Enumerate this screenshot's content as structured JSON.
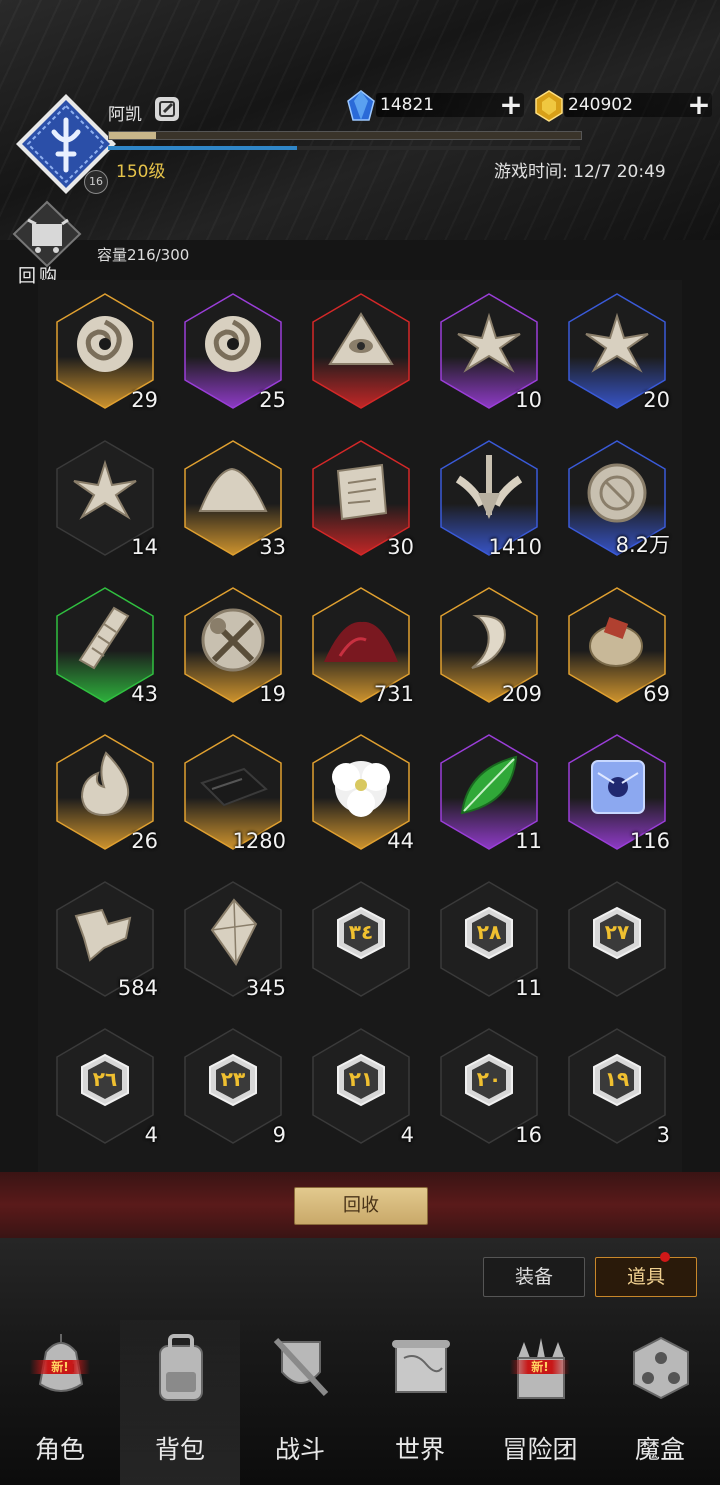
{
  "player": {
    "name": "阿凯",
    "level_text": "150级",
    "badge": "16",
    "xp_progress": 0.1,
    "mp_progress": 0.4
  },
  "currency": {
    "gems": "14821",
    "gold": "240902"
  },
  "game_time": "游戏时间: 12/7 20:49",
  "buyback": {
    "label": "回购"
  },
  "capacity": "容量216/300",
  "items": [
    {
      "count": "29",
      "rarity": "orange",
      "icon": "vortex-icon"
    },
    {
      "count": "25",
      "rarity": "purple",
      "icon": "vortex-icon"
    },
    {
      "count": "",
      "rarity": "red",
      "icon": "eye-pyramid-icon"
    },
    {
      "count": "10",
      "rarity": "purple",
      "icon": "crystal-shards-icon"
    },
    {
      "count": "20",
      "rarity": "blue",
      "icon": "crystal-shards-icon"
    },
    {
      "count": "14",
      "rarity": "none",
      "icon": "crystal-shards-icon"
    },
    {
      "count": "33",
      "rarity": "orange",
      "icon": "powder-pile-icon"
    },
    {
      "count": "30",
      "rarity": "red",
      "icon": "scroll-icon"
    },
    {
      "count": "1410",
      "rarity": "blue",
      "icon": "winged-sword-emblem-icon"
    },
    {
      "count": "8.2万",
      "rarity": "blue",
      "icon": "medallion-icon"
    },
    {
      "count": "43",
      "rarity": "green",
      "icon": "bandage-icon"
    },
    {
      "count": "19",
      "rarity": "orange",
      "icon": "crossed-tools-emblem-icon"
    },
    {
      "count": "731",
      "rarity": "orange",
      "icon": "red-powder-icon"
    },
    {
      "count": "209",
      "rarity": "orange",
      "icon": "fang-icon"
    },
    {
      "count": "69",
      "rarity": "orange",
      "icon": "pouch-icon"
    },
    {
      "count": "26",
      "rarity": "orange",
      "icon": "flame-icon"
    },
    {
      "count": "1280",
      "rarity": "orange",
      "icon": "black-card-icon"
    },
    {
      "count": "44",
      "rarity": "orange",
      "icon": "white-flower-icon"
    },
    {
      "count": "11",
      "rarity": "purple",
      "icon": "green-leaf-icon"
    },
    {
      "count": "116",
      "rarity": "purple",
      "icon": "ice-cube-icon"
    },
    {
      "count": "584",
      "rarity": "none",
      "icon": "rock-fragment-icon"
    },
    {
      "count": "345",
      "rarity": "none",
      "icon": "crystal-icon"
    },
    {
      "count": "",
      "rarity": "none",
      "icon": "rune-gem-icon",
      "rune": "٣٤"
    },
    {
      "count": "11",
      "rarity": "none",
      "icon": "rune-gem-icon",
      "rune": "٢٨"
    },
    {
      "count": "",
      "rarity": "none",
      "icon": "rune-gem-icon",
      "rune": "٢٧"
    },
    {
      "count": "4",
      "rarity": "none",
      "icon": "rune-gem-icon",
      "rune": "٢٦"
    },
    {
      "count": "9",
      "rarity": "none",
      "icon": "rune-gem-icon",
      "rune": "٢٣"
    },
    {
      "count": "4",
      "rarity": "none",
      "icon": "rune-gem-icon",
      "rune": "٢١"
    },
    {
      "count": "16",
      "rarity": "none",
      "icon": "rune-gem-icon",
      "rune": "٢٠"
    },
    {
      "count": "3",
      "rarity": "none",
      "icon": "rune-gem-icon",
      "rune": "١٩"
    }
  ],
  "recycle_label": "回收",
  "tabs": {
    "equip": "装备",
    "items": "道具"
  },
  "new_tag": "新!",
  "nav": [
    {
      "label": "角色",
      "icon": "helmet-icon",
      "new": true
    },
    {
      "label": "背包",
      "icon": "backpack-icon",
      "active": true
    },
    {
      "label": "战斗",
      "icon": "sword-shield-icon"
    },
    {
      "label": "世界",
      "icon": "map-icon"
    },
    {
      "label": "冒险团",
      "icon": "castle-icon",
      "new": true
    },
    {
      "label": "魔盒",
      "icon": "magic-cube-icon"
    }
  ],
  "colors": {
    "orange": "#e0a030",
    "purple": "#9a3ed8",
    "red": "#d42828",
    "blue": "#3a5ad8",
    "green": "#30c040",
    "none": "#3a3a3a"
  }
}
